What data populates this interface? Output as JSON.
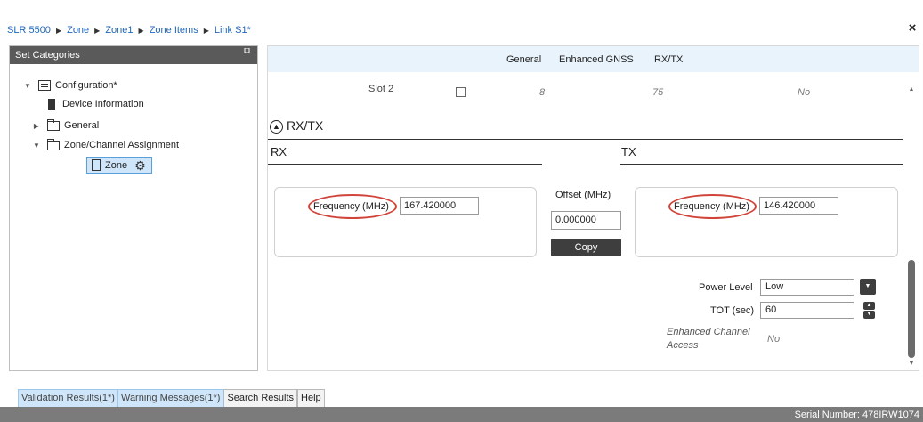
{
  "breadcrumb": {
    "items": [
      "SLR 5500",
      "Zone",
      "Zone1",
      "Zone Items",
      "Link S1*"
    ],
    "separator": "▶"
  },
  "window": {
    "close_label": "×"
  },
  "left_panel": {
    "title": "Set Categories",
    "pin_icon": "📌",
    "tree": {
      "configuration": "Configuration*",
      "device_information": "Device Information",
      "general": "General",
      "zone_channel_assignment": "Zone/Channel Assignment",
      "zone": "Zone"
    }
  },
  "tabs": [
    "General",
    "Enhanced GNSS",
    "RX/TX"
  ],
  "slot_row": {
    "label": "Slot 2",
    "value_a": "8",
    "value_b": "75",
    "value_c": "No"
  },
  "rxtx": {
    "section_title": "RX/TX",
    "rx_title": "RX",
    "tx_title": "TX",
    "rx_frequency_label": "Frequency (MHz)",
    "rx_frequency_value": "167.420000",
    "offset_label": "Offset (MHz)",
    "offset_value": "0.000000",
    "copy_label": "Copy",
    "tx_frequency_label": "Frequency (MHz)",
    "tx_frequency_value": "146.420000"
  },
  "settings": {
    "power_level_label": "Power Level",
    "power_level_value": "Low",
    "tot_label": "TOT (sec)",
    "tot_value": "60",
    "eca_label_line1": "Enhanced Channel",
    "eca_label_line2": "Access",
    "eca_value": "No"
  },
  "bottom_tabs": [
    "Validation Results(1*)",
    "Warning Messages(1*)",
    "Search Results",
    "Help"
  ],
  "status": {
    "serial": "Serial Number: 478IRW1074"
  },
  "colors": {
    "accent_blue": "#1e66b8",
    "header_gray": "#5a5a5a",
    "tab_strip": "#e9f3fb",
    "highlight_oval": "#d0443a",
    "button_dark": "#3e3e3e"
  }
}
